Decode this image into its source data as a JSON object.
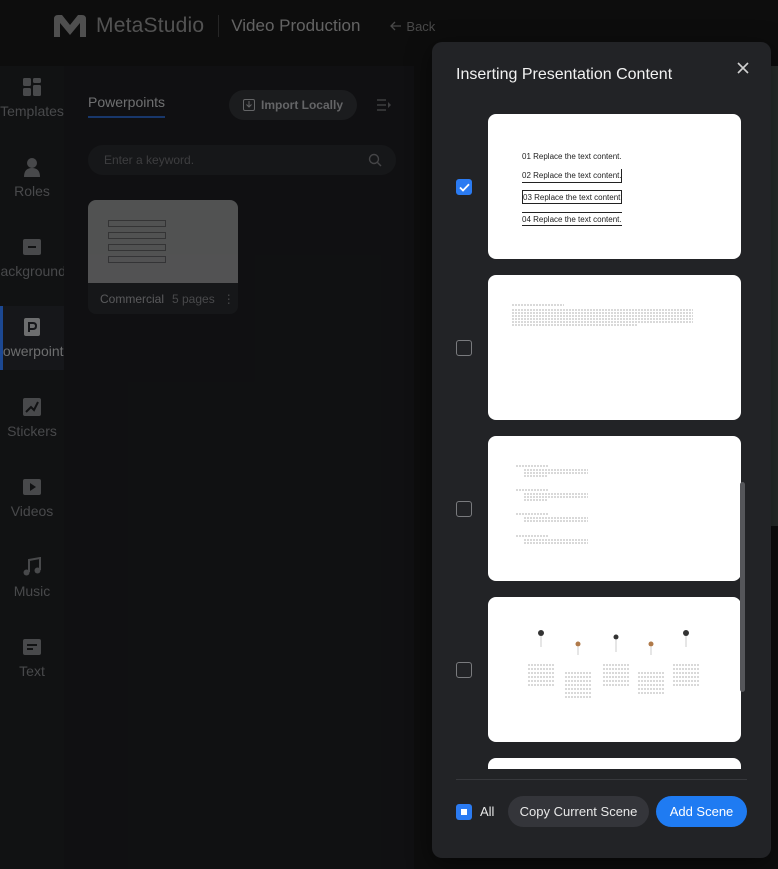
{
  "app": {
    "logo_text": "MetaStudio",
    "page_title": "Video Production",
    "back_label": "Back"
  },
  "sidebar": {
    "items": [
      {
        "label": "Templates",
        "icon": "templates-icon"
      },
      {
        "label": "Roles",
        "icon": "person-icon"
      },
      {
        "label": "Backgrounds",
        "icon": "background-icon"
      },
      {
        "label": "Powerpoints",
        "icon": "powerpoint-icon",
        "active": true
      },
      {
        "label": "Stickers",
        "icon": "sticker-icon"
      },
      {
        "label": "Videos",
        "icon": "video-icon"
      },
      {
        "label": "Music",
        "icon": "music-icon"
      },
      {
        "label": "Text",
        "icon": "text-icon"
      }
    ],
    "active_color": "#2b6fe0"
  },
  "panel": {
    "tab_label": "Powerpoints",
    "import_label": "Import Locally",
    "search_placeholder": "Enter a keyword.",
    "file": {
      "name": "Commercial",
      "pages": "5 pages"
    }
  },
  "modal": {
    "title": "Inserting Presentation Content",
    "slides": [
      {
        "checked": true,
        "items": [
          "01 Replace the text content.",
          "02 Replace the text content.",
          "03 Replace the text content.",
          "04 Replace the text content."
        ]
      },
      {
        "checked": false
      },
      {
        "checked": false
      },
      {
        "checked": false
      }
    ],
    "footer": {
      "all_label": "All",
      "copy_label": "Copy Current Scene",
      "add_label": "Add Scene"
    },
    "accent_color": "#1f7bf2"
  }
}
